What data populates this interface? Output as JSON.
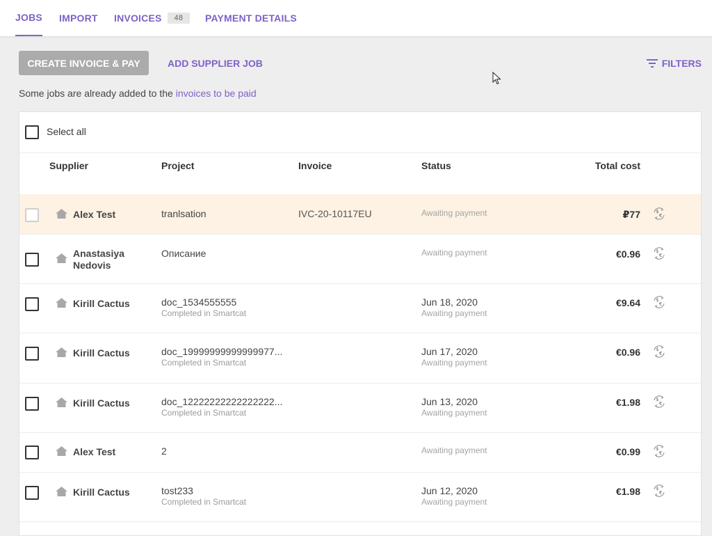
{
  "tabs": [
    {
      "label": "JOBS"
    },
    {
      "label": "IMPORT"
    },
    {
      "label": "INVOICES",
      "count": "48"
    },
    {
      "label": "PAYMENT DETAILS"
    }
  ],
  "toolbar": {
    "create_label": "CREATE INVOICE & PAY",
    "add_label": "ADD SUPPLIER JOB",
    "filters_label": "FILTERS"
  },
  "notice": {
    "text": "Some jobs are already added to the ",
    "link": "invoices to be paid"
  },
  "table": {
    "select_all": "Select all",
    "headers": {
      "supplier": "Supplier",
      "project": "Project",
      "invoice": "Invoice",
      "status": "Status",
      "total": "Total cost"
    },
    "rows": [
      {
        "supplier_line1": "Alex Test",
        "supplier_line2": "",
        "project": "tranlsation",
        "project_sub": "",
        "invoice": "IVC-20-10117EU",
        "status_date": "",
        "status": "Awaiting payment",
        "cost": "₽77"
      },
      {
        "supplier_line1": "Anastasiya",
        "supplier_line2": "Nedovis",
        "project": "Описание",
        "project_sub": "",
        "invoice": "",
        "status_date": "",
        "status": "Awaiting payment",
        "cost": "€0.96"
      },
      {
        "supplier_line1": "Kirill Cactus",
        "supplier_line2": "",
        "project": "doc_1534555555",
        "project_sub": "Completed in Smartcat",
        "invoice": "",
        "status_date": "Jun 18, 2020",
        "status": "Awaiting payment",
        "cost": "€9.64"
      },
      {
        "supplier_line1": "Kirill Cactus",
        "supplier_line2": "",
        "project": "doc_19999999999999977...",
        "project_sub": "Completed in Smartcat",
        "invoice": "",
        "status_date": "Jun 17, 2020",
        "status": "Awaiting payment",
        "cost": "€0.96"
      },
      {
        "supplier_line1": "Kirill Cactus",
        "supplier_line2": "",
        "project": "doc_12222222222222222...",
        "project_sub": "Completed in Smartcat",
        "invoice": "",
        "status_date": "Jun 13, 2020",
        "status": "Awaiting payment",
        "cost": "€1.98"
      },
      {
        "supplier_line1": "Alex Test",
        "supplier_line2": "",
        "project": "2",
        "project_sub": "",
        "invoice": "",
        "status_date": "",
        "status": "Awaiting payment",
        "cost": "€0.99"
      },
      {
        "supplier_line1": "Kirill Cactus",
        "supplier_line2": "",
        "project": "tost233",
        "project_sub": "Completed in Smartcat",
        "invoice": "",
        "status_date": "Jun 12, 2020",
        "status": "Awaiting payment",
        "cost": "€1.98"
      }
    ]
  },
  "icons": {
    "supplier": "home-icon",
    "currency": "currency-exchange-icon",
    "filters": "filter-lines-icon"
  },
  "colors": {
    "accent": "#7d62c6",
    "disabled_button": "#ababab",
    "highlight_row": "#fdf2e3"
  }
}
